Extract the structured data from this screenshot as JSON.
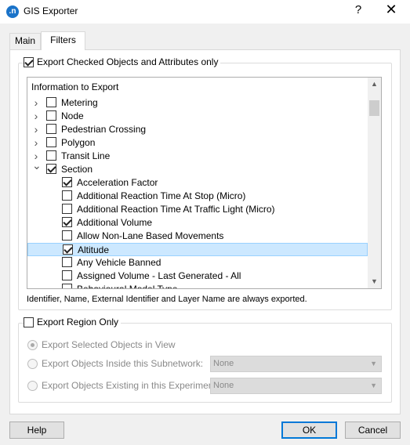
{
  "window": {
    "title": "GIS Exporter",
    "app_icon_letter": ".n",
    "help_glyph": "?",
    "close_glyph": "✕"
  },
  "tabs": [
    {
      "label": "Main"
    },
    {
      "label": "Filters"
    }
  ],
  "export_checked": {
    "label": "Export Checked Objects and Attributes only",
    "checked": true
  },
  "list": {
    "header": "Information to Export",
    "items": [
      {
        "label": "Metering",
        "checked": false,
        "level": 0,
        "expanded": false
      },
      {
        "label": "Node",
        "checked": false,
        "level": 0,
        "expanded": false
      },
      {
        "label": "Pedestrian Crossing",
        "checked": false,
        "level": 0,
        "expanded": false
      },
      {
        "label": "Polygon",
        "checked": false,
        "level": 0,
        "expanded": false
      },
      {
        "label": "Transit Line",
        "checked": false,
        "level": 0,
        "expanded": false
      },
      {
        "label": "Section",
        "checked": true,
        "level": 0,
        "expanded": true
      },
      {
        "label": "Acceleration Factor",
        "checked": true,
        "level": 1
      },
      {
        "label": "Additional Reaction Time At Stop (Micro)",
        "checked": false,
        "level": 1
      },
      {
        "label": "Additional Reaction Time At Traffic Light (Micro)",
        "checked": false,
        "level": 1
      },
      {
        "label": "Additional Volume",
        "checked": true,
        "level": 1
      },
      {
        "label": "Allow Non-Lane Based Movements",
        "checked": false,
        "level": 1
      },
      {
        "label": "Altitude",
        "checked": true,
        "level": 1,
        "selected": true
      },
      {
        "label": "Any Vehicle Banned",
        "checked": false,
        "level": 1
      },
      {
        "label": "Assigned Volume - Last Generated - All",
        "checked": false,
        "level": 1
      },
      {
        "label": "Behavioural Model Type",
        "checked": false,
        "level": 1
      }
    ]
  },
  "note": "Identifier, Name, External Identifier and Layer Name are always exported.",
  "region": {
    "label": "Export Region Only",
    "checked": false,
    "options": [
      {
        "label": "Export Selected Objects in View",
        "selected": true
      },
      {
        "label": "Export Objects Inside this Subnetwork:",
        "selected": false,
        "select_value": "None"
      },
      {
        "label": "Export Objects Existing in this Experiment:",
        "selected": false,
        "select_value": "None"
      }
    ]
  },
  "buttons": {
    "help": "Help",
    "ok": "OK",
    "cancel": "Cancel"
  }
}
